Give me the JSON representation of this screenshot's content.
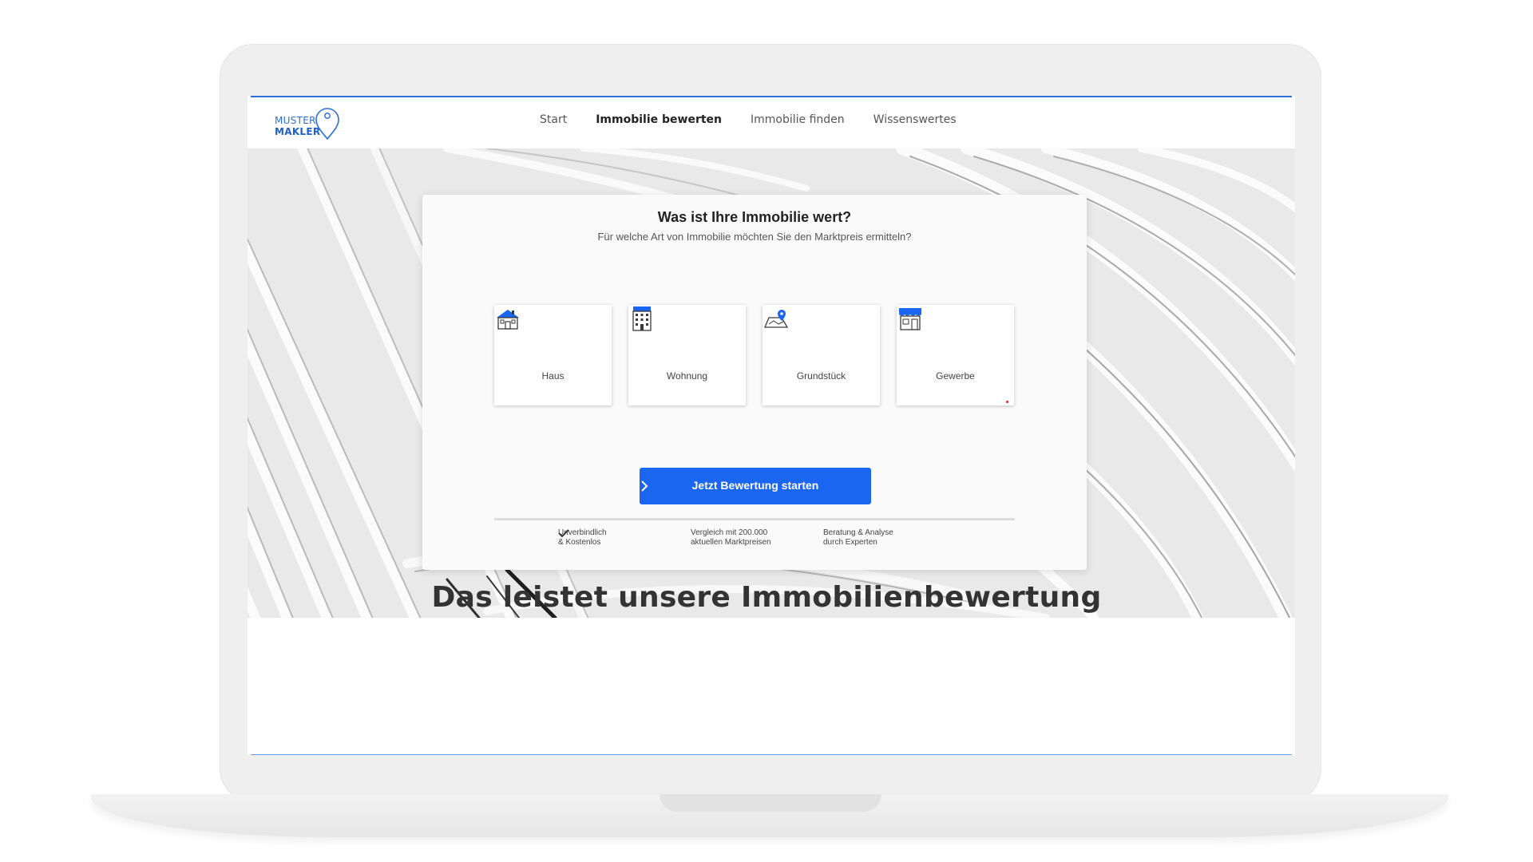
{
  "brand": {
    "line1": "MUSTER",
    "line2": "MAKLER",
    "accent_color": "#1a66f0"
  },
  "nav": {
    "items": [
      {
        "label": "Start",
        "active": false
      },
      {
        "label": "Immobilie bewerten",
        "active": true
      },
      {
        "label": "Immobilie finden",
        "active": false
      },
      {
        "label": "Wissenswertes",
        "active": false
      }
    ]
  },
  "valuation": {
    "title": "Was ist Ihre Immobilie wert?",
    "subtitle": "Für welche Art von Immobilie möchten Sie den Marktpreis ermitteln?",
    "options": [
      {
        "label": "Haus",
        "icon": "house-icon"
      },
      {
        "label": "Wohnung",
        "icon": "apartment-building-icon"
      },
      {
        "label": "Grundstück",
        "icon": "land-plot-icon"
      },
      {
        "label": "Gewerbe",
        "icon": "storefront-icon"
      }
    ],
    "cta_label": "Jetzt Bewertung starten",
    "benefits": [
      {
        "line1": "Unverbindlich",
        "line2": "& Kostenlos"
      },
      {
        "line1": "Vergleich mit 200.000",
        "line2": "aktuellen Marktpreisen"
      },
      {
        "line1": "Beratung & Analyse",
        "line2": "durch Experten"
      }
    ]
  },
  "section": {
    "heading": "Das leistet unsere Immobilienbewertung"
  }
}
